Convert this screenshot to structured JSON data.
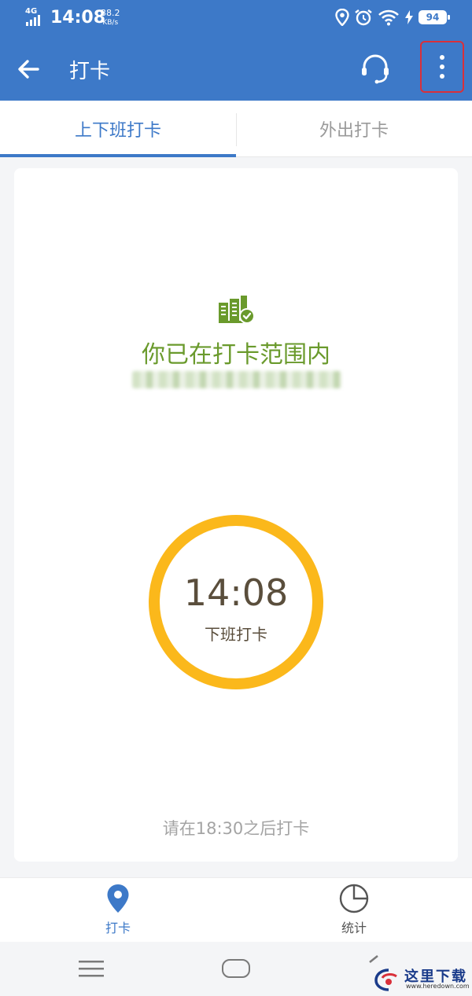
{
  "status_bar": {
    "network": "4G",
    "time": "14:08",
    "speed_value": "38.2",
    "speed_unit": "KB/s",
    "battery": "94"
  },
  "app_bar": {
    "title": "打卡"
  },
  "tabs": [
    {
      "label": "上下班打卡",
      "active": true
    },
    {
      "label": "外出打卡",
      "active": false
    }
  ],
  "card": {
    "range_status": "你已在打卡范围内",
    "clock_time": "14:08",
    "clock_label": "下班打卡",
    "hint": "请在18:30之后打卡"
  },
  "bottom_nav": [
    {
      "label": "打卡",
      "icon": "location-pin-icon",
      "active": true
    },
    {
      "label": "统计",
      "icon": "pie-chart-icon",
      "active": false
    }
  ],
  "watermark": {
    "text": "这里下载",
    "sub": "www.heredown.com"
  },
  "colors": {
    "primary": "#3d79c8",
    "success_green": "#6a9a2c",
    "clock_ring": "#fbb81b",
    "highlight_box": "#d9303a"
  }
}
